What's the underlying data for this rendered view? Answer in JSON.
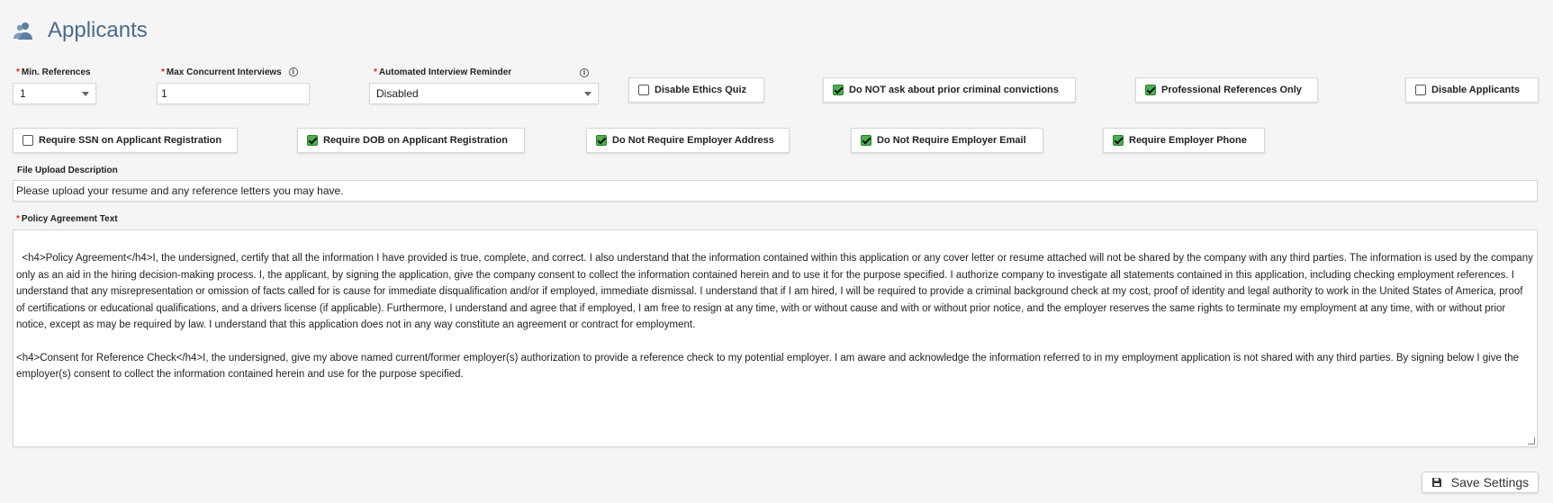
{
  "header": {
    "title": "Applicants",
    "icon": "users-icon"
  },
  "fields": {
    "min_references": {
      "label": "Min. References",
      "value": "1"
    },
    "max_interviews": {
      "label": "Max Concurrent Interviews",
      "value": "1"
    },
    "reminder": {
      "label": "Automated Interview Reminder",
      "value": "Disabled"
    }
  },
  "checkboxes": {
    "disable_ethics": {
      "label": "Disable Ethics Quiz",
      "checked": false
    },
    "no_criminal": {
      "label": "Do NOT ask about prior criminal convictions",
      "checked": true
    },
    "prof_refs": {
      "label": "Professional References Only",
      "checked": true
    },
    "disable_applicants": {
      "label": "Disable Applicants",
      "checked": false
    },
    "require_ssn": {
      "label": "Require SSN on Applicant Registration",
      "checked": false
    },
    "require_dob": {
      "label": "Require DOB on Applicant Registration",
      "checked": true
    },
    "no_emp_address": {
      "label": "Do Not Require Employer Address",
      "checked": true
    },
    "no_emp_email": {
      "label": "Do Not Require Employer Email",
      "checked": true
    },
    "require_emp_phone": {
      "label": "Require Employer Phone",
      "checked": true
    }
  },
  "file_upload": {
    "label": "File Upload Description",
    "value": "Please upload your resume and any reference letters you may have."
  },
  "policy": {
    "label": "Policy Agreement Text",
    "value": "<h4>Policy Agreement</h4>I, the undersigned, certify that all the information I have provided is true, complete, and correct. I also understand that the information contained within this application or any cover letter or resume attached will not be shared by the company with any third parties. The information is used by the company only as an aid in the hiring decision-making process. I, the applicant, by signing the application, give the company consent to collect the information contained herein and to use it for the purpose specified. I authorize company to investigate all statements contained in this application, including checking employment references. I understand that any misrepresentation or omission of facts called for is cause for immediate disqualification and/or if employed, immediate dismissal. I understand that if I am hired, I will be required to provide a criminal background check at my cost, proof of identity and legal authority to work in the United States of America, proof of certifications or educational qualifications, and a drivers license (if applicable). Furthermore, I understand and agree that if employed, I am free to resign at any time, with or without cause and with or without prior notice, and the employer reserves the same rights to terminate my employment at any time, with or without prior notice, except as may be required by law. I understand that this application does not in any way constitute an agreement or contract for employment.\n\n<h4>Consent for Reference Check</h4>I, the undersigned, give my above named current/former employer(s) authorization to provide a reference check to my potential employer. I am aware and acknowledge the information referred to in my employment application is not shared with any third parties. By signing below I give the employer(s) consent to collect the information contained herein and use for the purpose specified."
  },
  "actions": {
    "save_label": "Save Settings"
  },
  "colors": {
    "title": "#4a6a8a",
    "required": "#d8262b",
    "checked": "#4caf50"
  }
}
